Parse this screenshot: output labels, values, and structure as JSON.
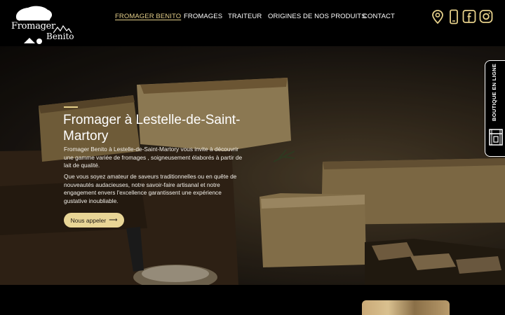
{
  "brand": {
    "line1": "Fromager",
    "line2": "Benito"
  },
  "nav": {
    "items": [
      {
        "label": "FROMAGER BENITO",
        "active": true
      },
      {
        "label": "FROMAGES",
        "active": false
      },
      {
        "label": "TRAITEUR",
        "active": false
      },
      {
        "label": "ORIGINES DE NOS PRODUITS",
        "active": false
      },
      {
        "label": "CONTACT",
        "active": false
      }
    ]
  },
  "social": [
    "map-pin-icon",
    "phone-icon",
    "facebook-icon",
    "instagram-icon"
  ],
  "hero": {
    "title": "Fromager à Lestelle-de-Saint-Martory",
    "p1": "Fromager Benito à Lestelle-de-Saint-Martory vous invite à découvrir une gamme variée de fromages , soigneusement élaborés à partir de lait de qualité.",
    "p2": "Que vous soyez amateur de saveurs traditionnelles ou en quête de nouveautés audacieuses, notre savoir-faire artisanal et notre engagement envers l'excellence garantissent une expérience gustative inoubliable.",
    "cta_label": "Nous appeler",
    "cta_arrow": "⟶"
  },
  "side_tab": {
    "label": "BOUTIQUE EN LIGNE"
  },
  "colors": {
    "accent": "#e6d08a",
    "button": "#e8d596",
    "background": "#000000"
  }
}
